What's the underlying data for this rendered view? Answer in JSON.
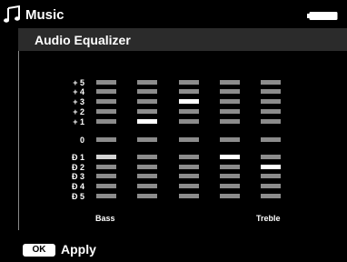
{
  "header": {
    "app_title": "Music",
    "icon": "music-note-icon",
    "battery_icon": "battery-icon"
  },
  "panel": {
    "title": "Audio Equalizer"
  },
  "equalizer": {
    "levels": [
      "+ 5",
      "+ 4",
      "+ 3",
      "+ 2",
      "+ 1",
      "0",
      "Ð 1",
      "Ð 2",
      "Ð 3",
      "Ð 4",
      "Ð 5"
    ],
    "bands": [
      {
        "label": "Bass",
        "selected_level": "Ð 1"
      },
      {
        "label": "",
        "selected_level": "+ 1"
      },
      {
        "label": "",
        "selected_level": "+ 3"
      },
      {
        "label": "",
        "selected_level": "Ð 1"
      },
      {
        "label": "Treble",
        "selected_level": "Ð 2"
      }
    ],
    "focused_band_index": 0
  },
  "colors": {
    "background": "#000000",
    "segment": "#8c8c8c",
    "selected": "#ffffff",
    "focused_selected": "#d4d4d4",
    "header_bar": "#2b2b2b"
  },
  "footer": {
    "ok_label": "OK",
    "apply_label": "Apply"
  }
}
